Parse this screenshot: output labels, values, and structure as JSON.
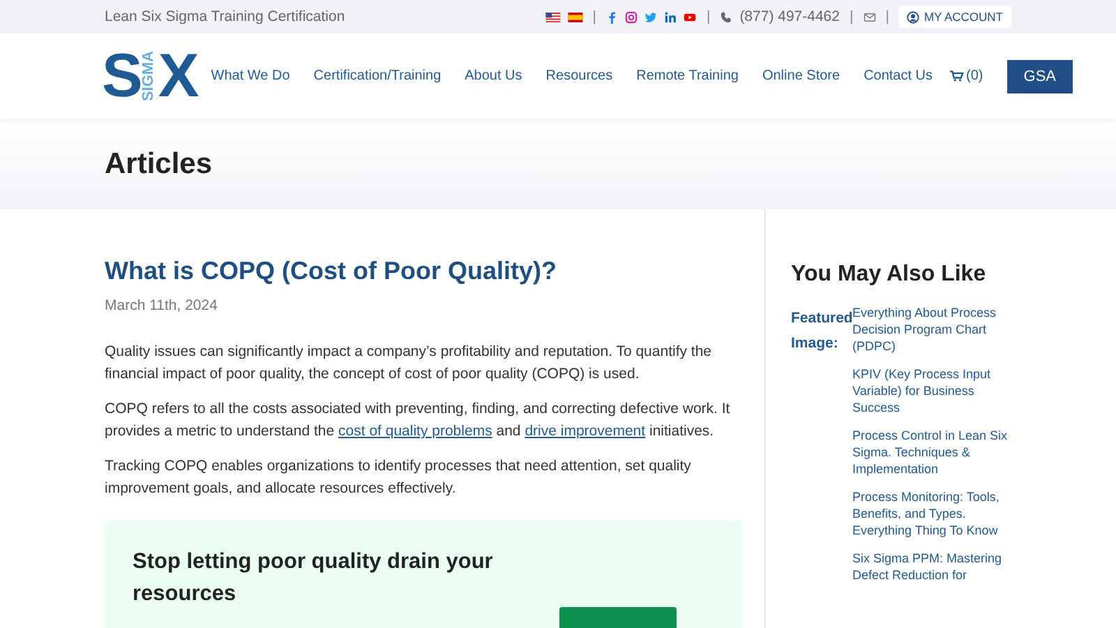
{
  "topbar": {
    "tagline": "Lean Six Sigma Training Certification",
    "phone": "(877) 497-4462",
    "account": "MY ACCOUNT",
    "separator": "|"
  },
  "logo": {
    "left": "S",
    "middle": "SIGMA",
    "right": "X"
  },
  "nav": {
    "items": [
      "What We Do",
      "Certification/Training",
      "About Us",
      "Resources",
      "Remote Training",
      "Online Store",
      "Contact Us"
    ],
    "cart": "(0)",
    "button": "GSA"
  },
  "banner": {
    "title": "Articles"
  },
  "article": {
    "title": "What is COPQ (Cost of Poor Quality)?",
    "date": "March 11th, 2024",
    "paragraphs": [
      "Quality issues can significantly impact a company’s profitability and reputation. To quantify the financial impact of poor quality, the concept of cost of poor quality (COPQ) is used.",
      [
        {
          "kind": "text",
          "text": "COPQ refers to all the costs associated with preventing, finding, and correcting defective work. It provides a metric to understand the "
        },
        {
          "kind": "link",
          "text": "cost of quality problems"
        },
        {
          "kind": "text",
          "text": " and "
        },
        {
          "kind": "link",
          "text": "drive improvement"
        },
        {
          "kind": "text",
          "text": " initiatives."
        }
      ],
      "Tracking COPQ enables organizations to identify processes that need attention, set quality improvement goals, and allocate resources effectively."
    ],
    "cta": {
      "title": "Stop letting poor quality drain your resources"
    }
  },
  "sidebar": {
    "title": "You May Also Like",
    "items": [
      {
        "thumb_alt": "Featured Image:",
        "title": "Everything About Process Decision Program Chart (PDPC)"
      },
      {
        "title": "KPIV (Key Process Input Variable) for Business Success"
      },
      {
        "title": "Process Control in Lean Six Sigma. Techniques & Implementation"
      },
      {
        "title": "Process Monitoring: Tools, Benefits, and Types. Everything Thing To Know"
      },
      {
        "title": "Six Sigma PPM: Mastering Defect Reduction for"
      }
    ]
  }
}
